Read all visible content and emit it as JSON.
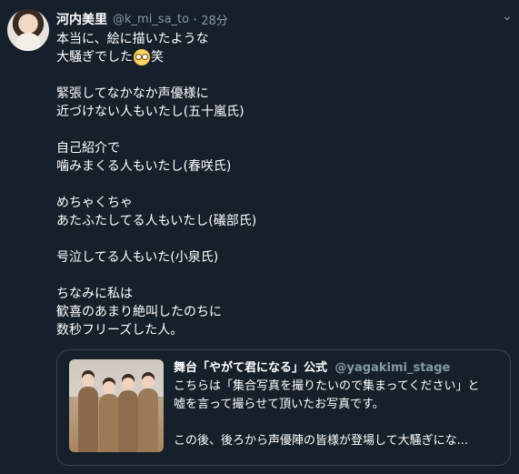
{
  "tweet": {
    "author_name": "河内美里",
    "author_handle": "@k_mi_sa_to",
    "separator": "·",
    "time": "28分",
    "menu_icon": "chevron-down-icon",
    "text_lines": [
      "本当に、絵に描いたような",
      "大騒ぎでした",
      "",
      "緊張してなかなか声優様に",
      "近づけない人もいたし(五十嵐氏)",
      "",
      "自己紹介で",
      "噛みまくる人もいたし(春咲氏)",
      "",
      "めちゃくちゃ",
      "あたふたしてる人もいたし(礒部氏)",
      "",
      "号泣してる人もいた(小泉氏)",
      "",
      "ちなみに私は",
      "歓喜のあまり絶叫したのちに",
      "数秒フリーズした人。"
    ],
    "emoji_name": "flushed-face-emoji",
    "emoji_suffix": "笑"
  },
  "quoted_tweet": {
    "author_name": "舞台「やがて君になる」公式",
    "author_handle": "@yagakimi_stage",
    "lines": [
      "こちらは「集合写真を撮りたいので集まってください」と",
      "嘘を言って撮らせて頂いたお写真です。",
      "",
      "この後、後ろから声優陣の皆様が登場して大騒ぎにな..."
    ],
    "image_description": "photo"
  }
}
